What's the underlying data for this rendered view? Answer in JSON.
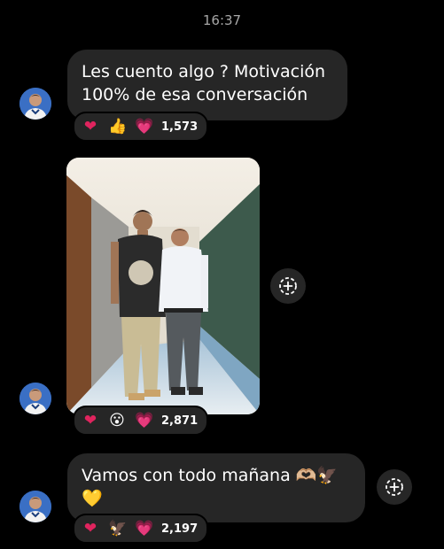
{
  "timestamp": "16:37",
  "messages": [
    {
      "text": "Les cuento algo ? Motivación 100% de esa conversación",
      "reactions": [
        "❤",
        "👍",
        "💗"
      ],
      "reaction_count": "1,573"
    },
    {
      "type": "photo",
      "reactions": [
        "❤",
        "😮",
        "💗"
      ],
      "reaction_count": "2,871"
    },
    {
      "text": "Vamos con todo mañana 🫶🏼🦅💛",
      "reactions": [
        "❤",
        "🦅",
        "💗"
      ],
      "reaction_count": "2,197"
    }
  ],
  "icons": {
    "avatar": "avatar-icon",
    "share": "share-plus-icon"
  },
  "colors": {
    "background": "#000000",
    "bubble": "#262626",
    "timestamp": "#a7a7a7"
  }
}
